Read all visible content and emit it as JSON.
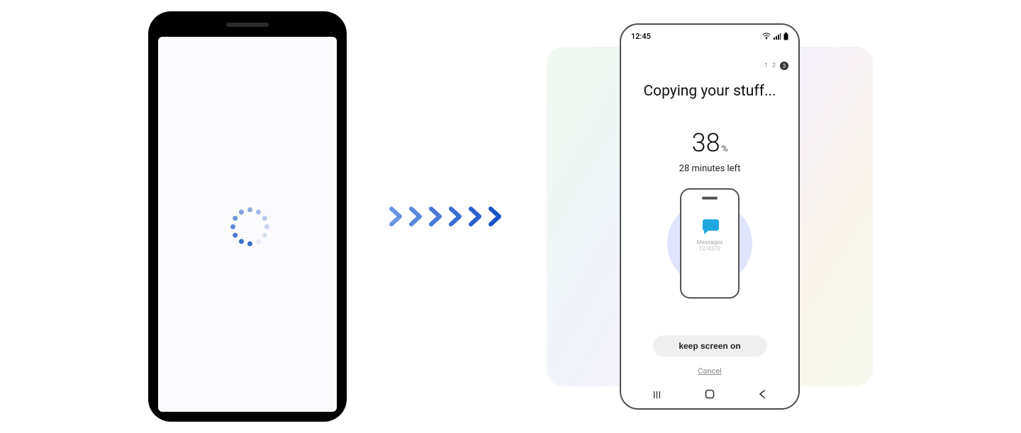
{
  "right": {
    "statusbar": {
      "time": "12:45"
    },
    "stepper": {
      "s1": "1",
      "s2": "2",
      "s3": "3"
    },
    "title": "Copying your stuff...",
    "percent": "38",
    "percent_symbol": "%",
    "eta": "28 minutes left",
    "transfer": {
      "category_label": "Messages",
      "count": "12/4372"
    },
    "keep_screen_button": "keep screen on",
    "cancel": "Cancel"
  }
}
